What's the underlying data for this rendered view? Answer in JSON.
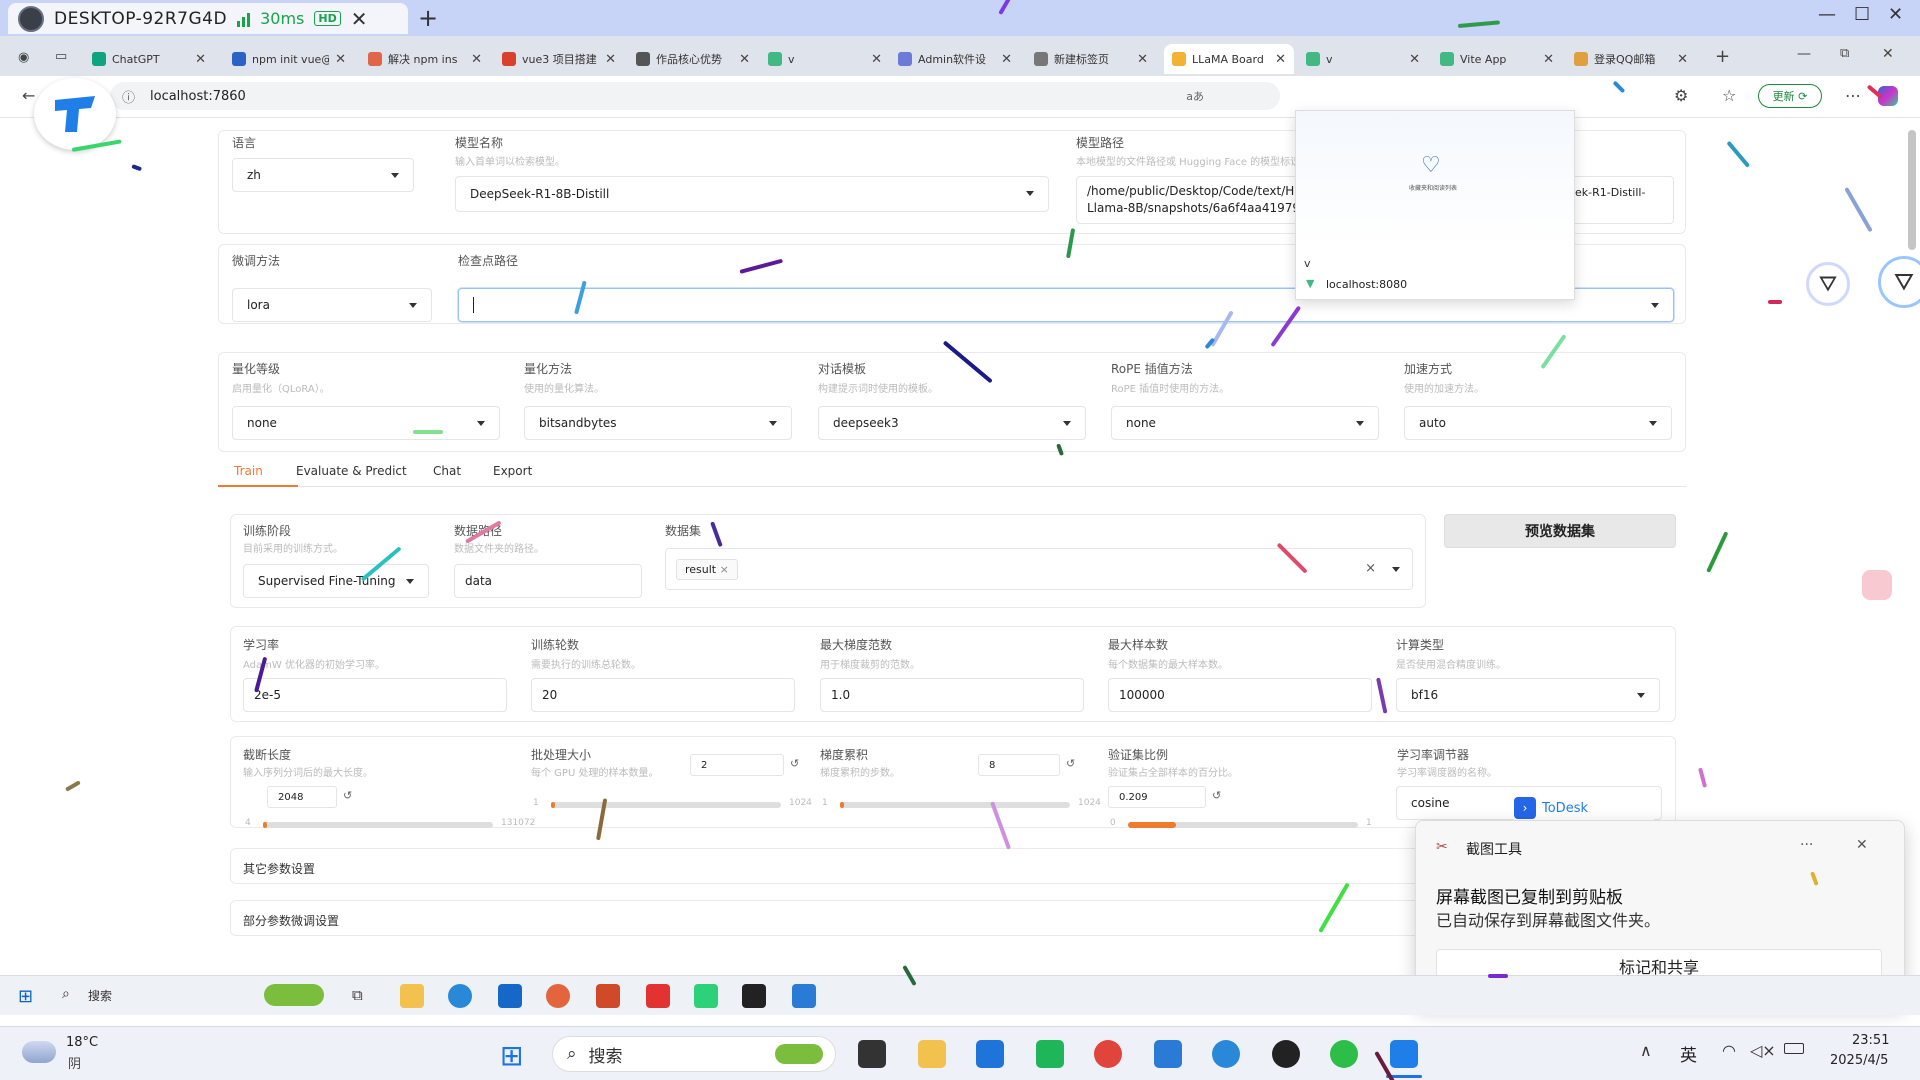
{
  "remote": {
    "title": "DESKTOP-92R7G4D",
    "latency": "30ms",
    "quality": "HD",
    "close": "✕",
    "new_tab": "+"
  },
  "browser": {
    "tabs": [
      {
        "label": "ChatGPT",
        "color": "#10a37f"
      },
      {
        "label": "npm init vue@",
        "color": "#2b62c6"
      },
      {
        "label": "解决 npm ins",
        "color": "#e0664a"
      },
      {
        "label": "vue3 项目搭建",
        "color": "#d9412c"
      },
      {
        "label": "作品核心优势",
        "color": "#555555"
      },
      {
        "label": "v",
        "color": "#42b883"
      },
      {
        "label": "Admin软件设",
        "color": "#6b7bd8"
      },
      {
        "label": "新建标签页",
        "color": "#777777"
      },
      {
        "label": "LLaMA Board",
        "color": "#f2b233"
      },
      {
        "label": "v",
        "color": "#42b883"
      },
      {
        "label": "Vite App",
        "color": "#42b883"
      },
      {
        "label": "登录QQ邮箱",
        "color": "#e0a040"
      }
    ],
    "url": "localhost:7860",
    "update_label": "更新",
    "popup": {
      "items": [
        "v",
        "localhost:8080"
      ],
      "preview_title": "收藏夹和阅读列表"
    }
  },
  "form": {
    "lang": {
      "label": "语言",
      "value": "zh"
    },
    "model_name": {
      "label": "模型名称",
      "sub": "输入首单词以检索模型。",
      "value": "DeepSeek-R1-8B-Distill"
    },
    "model_path": {
      "label": "模型路径",
      "sub": "本地模型的文件路径或 Hugging Face 的模型标识符。",
      "value_line1": "/home/public/Desktop/Code/text/H",
      "value_line2": "Llama-8B/snapshots/6a6f4aa41979",
      "value_right": "ek-R1-Distill-"
    },
    "finetune": {
      "label": "微调方法",
      "value": "lora"
    },
    "ckpt": {
      "label": "检查点路径",
      "value": ""
    },
    "quant_bit": {
      "label": "量化等级",
      "sub": "启用量化（QLoRA）。",
      "value": "none"
    },
    "quant_method": {
      "label": "量化方法",
      "sub": "使用的量化算法。",
      "value": "bitsandbytes"
    },
    "template": {
      "label": "对话模板",
      "sub": "构建提示词时使用的模板。",
      "value": "deepseek3"
    },
    "rope": {
      "label": "RoPE 插值方法",
      "sub": "RoPE 插值时使用的方法。",
      "value": "none"
    },
    "booster": {
      "label": "加速方式",
      "sub": "使用的加速方法。",
      "value": "auto"
    }
  },
  "tabs": [
    "Train",
    "Evaluate & Predict",
    "Chat",
    "Export"
  ],
  "train": {
    "stage": {
      "label": "训练阶段",
      "sub": "目前采用的训练方式。",
      "value": "Supervised Fine-Tuning"
    },
    "dataset_dir": {
      "label": "数据路径",
      "sub": "数据文件夹的路径。",
      "value": "data"
    },
    "dataset": {
      "label": "数据集",
      "chip": "result"
    },
    "preview_btn": "预览数据集",
    "lr": {
      "label": "学习率",
      "sub": "AdamW 优化器的初始学习率。",
      "value": "2e-5"
    },
    "epochs": {
      "label": "训练轮数",
      "sub": "需要执行的训练总轮数。",
      "value": "20"
    },
    "max_grad": {
      "label": "最大梯度范数",
      "sub": "用于梯度裁剪的范数。",
      "value": "1.0"
    },
    "max_samples": {
      "label": "最大样本数",
      "sub": "每个数据集的最大样本数。",
      "value": "100000"
    },
    "compute_type": {
      "label": "计算类型",
      "sub": "是否使用混合精度训练。",
      "value": "bf16"
    },
    "cutoff": {
      "label": "截断长度",
      "sub": "输入序列分词后的最大长度。",
      "value": "2048",
      "min": "4",
      "max": "131072",
      "fraction": 0.015
    },
    "batch": {
      "label": "批处理大小",
      "sub": "每个 GPU 处理的样本数量。",
      "value": "2",
      "min": "1",
      "max": "1024",
      "fraction": 0.001
    },
    "grad_acc": {
      "label": "梯度累积",
      "sub": "梯度累积的步数。",
      "value": "8",
      "min": "1",
      "max": "1024",
      "fraction": 0.007
    },
    "val_size": {
      "label": "验证集比例",
      "sub": "验证集占全部样本的百分比。",
      "value": "0.209",
      "min": "0",
      "max": "1",
      "fraction": 0.209
    },
    "scheduler": {
      "label": "学习率调节器",
      "sub": "学习率调度器的名称。",
      "value": "cosine"
    },
    "extra": "其它参数设置",
    "freeze": "部分参数微调设置"
  },
  "todesk": "ToDesk",
  "notification": {
    "app": "截图工具",
    "title": "屏幕截图已复制到剪贴板",
    "body": "已自动保存到屏幕截图文件夹。",
    "action": "标记和共享"
  },
  "inner_taskbar": {
    "search": "搜索"
  },
  "taskbar": {
    "weather_temp": "18°C",
    "weather_desc": "阴",
    "search": "搜索",
    "ime": "英",
    "time": "23:51",
    "date": "2025/4/5"
  }
}
